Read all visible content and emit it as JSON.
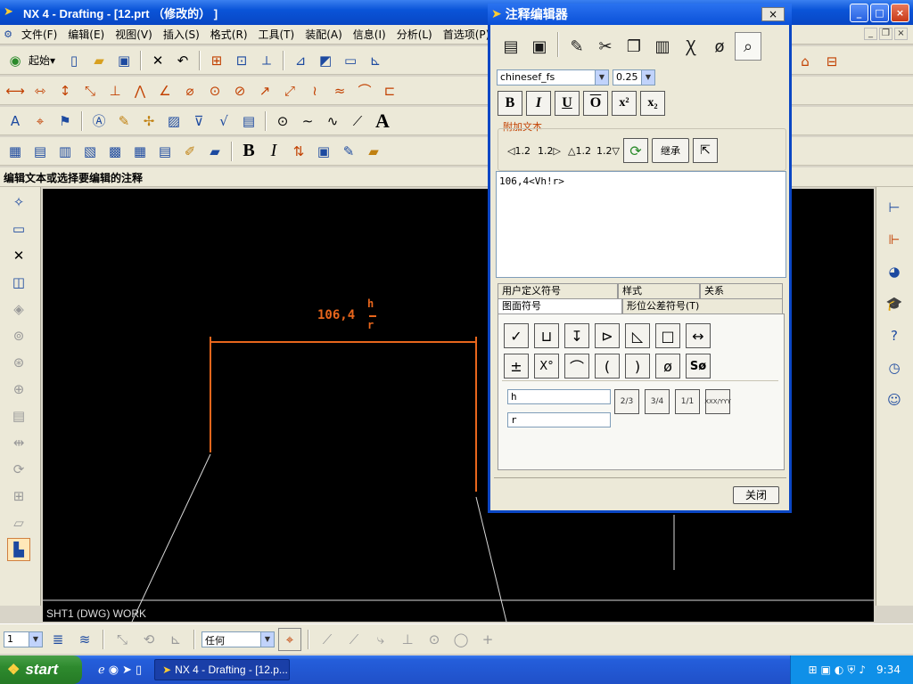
{
  "window": {
    "title": "NX 4 - Drafting - [12.prt （修改的） ]",
    "min": "_",
    "max": "□",
    "close": "×"
  },
  "menu": [
    "文件(F)",
    "编辑(E)",
    "视图(V)",
    "插入(S)",
    "格式(R)",
    "工具(T)",
    "装配(A)",
    "信息(I)",
    "分析(L)",
    "首选项(P)"
  ],
  "toolbar": {
    "start_label": "起始▾",
    "bold": "B",
    "italic": "I",
    "text_a": "A"
  },
  "status_prompt": "编辑文本或选择要编辑的注释",
  "canvas": {
    "sheet_label": "SHT1 (DWG) WORK",
    "annotation": "106,4",
    "stack_top": "h",
    "stack_bottom": "r",
    "colors": {
      "background": "#000000",
      "annotation": "#e8661c",
      "lines": "#e0e0e0"
    }
  },
  "dialog": {
    "title": "注释编辑器",
    "close_x": "×",
    "font": "chinesef_fs",
    "size": "0.25",
    "format": {
      "bold": "B",
      "italic": "I",
      "underline": "U",
      "overline": "O",
      "superscript": "x²",
      "subscript": "x₂"
    },
    "group_title": "附加文本",
    "group_buttons": [
      "◁1.2",
      "1.2▷",
      "△1.2",
      "1.2▽"
    ],
    "inherit": "继承",
    "text_content": "106,4<Vh!r>",
    "tabs_row1": [
      "用户定义符号",
      "样式",
      "关系"
    ],
    "tabs_row2": [
      "图面符号",
      "形位公差符号(T)"
    ],
    "symbols_row1": [
      "✓",
      "⊔",
      "↧",
      "⊳",
      "◺",
      "□",
      "↔"
    ],
    "symbols_row2": [
      "±",
      "X°",
      "⌒",
      "(",
      ")",
      "ø",
      "Sø"
    ],
    "upper_text": "h",
    "lower_text": "r",
    "fractions": [
      "2/3",
      "3/4",
      "1/1",
      "XXX/YYY"
    ],
    "close_button": "关闭"
  },
  "bottom": {
    "layer": "1",
    "filter": "任何"
  },
  "taskbar": {
    "start": "start",
    "task": "NX 4 - Drafting - [12.p...",
    "clock": "9:34"
  }
}
